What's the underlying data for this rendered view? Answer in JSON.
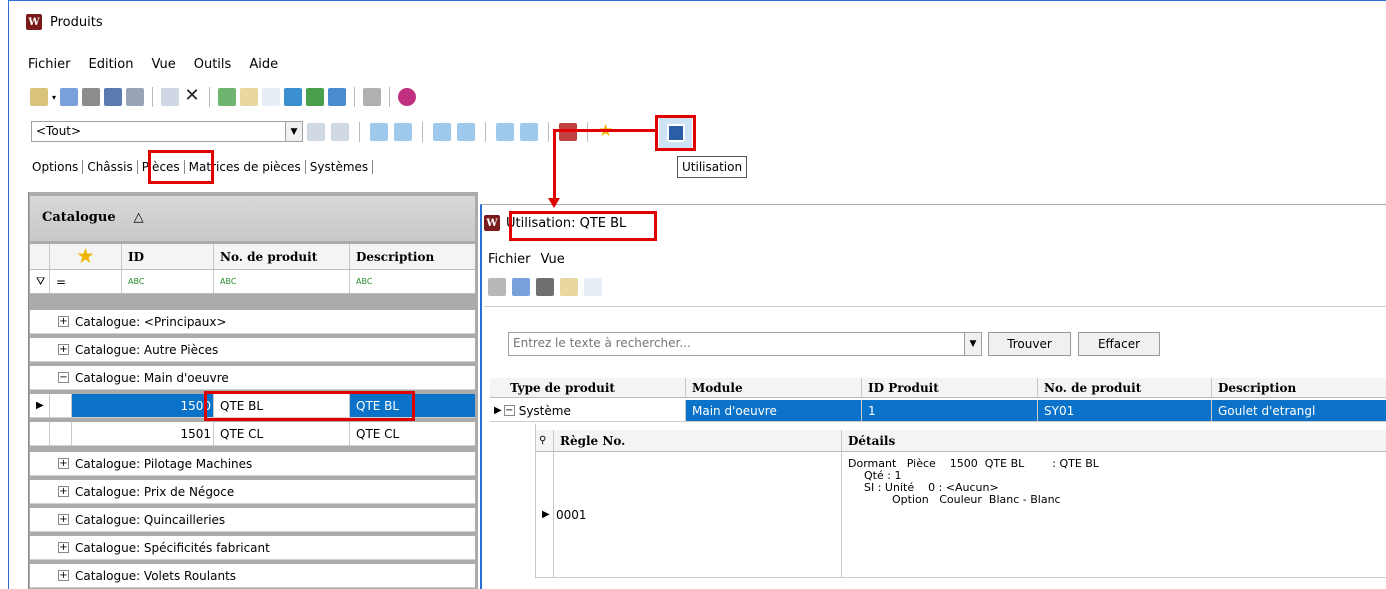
{
  "window": {
    "title": "Produits"
  },
  "menu": [
    "Fichier",
    "Edition",
    "Vue",
    "Outils",
    "Aide"
  ],
  "filter_combo": {
    "value": "<Tout>"
  },
  "tooltip": "Utilisation",
  "tabs": [
    "Options",
    "Châssis",
    "Pièces",
    "Matrices de pièces",
    "Systèmes"
  ],
  "catalog": {
    "group_header": "Catalogue",
    "sort_glyph": "△",
    "columns": [
      "ID",
      "No. de produit",
      "Description"
    ],
    "filter_glyph": "=",
    "filter_icon_text": "ABC",
    "groups": [
      {
        "label": "Catalogue: <Principaux>",
        "expander": "+"
      },
      {
        "label": "Catalogue: Autre Pièces",
        "expander": "+"
      },
      {
        "label": "Catalogue: Main d'oeuvre",
        "expander": "−"
      },
      {
        "label": "Catalogue: Pilotage Machines",
        "expander": "+"
      },
      {
        "label": "Catalogue: Prix de Négoce",
        "expander": "+"
      },
      {
        "label": "Catalogue: Quincailleries",
        "expander": "+"
      },
      {
        "label": "Catalogue: Spécificités fabricant",
        "expander": "+"
      },
      {
        "label": "Catalogue: Volets Roulants",
        "expander": "+"
      }
    ],
    "rows": [
      {
        "id": "1500",
        "product_no": "QTE BL",
        "description": "QTE BL"
      },
      {
        "id": "1501",
        "product_no": "QTE CL",
        "description": "QTE CL"
      }
    ]
  },
  "popup": {
    "title": "Utilisation: QTE BL",
    "menu": [
      "Fichier",
      "Vue"
    ],
    "search_placeholder": "Entrez le texte à rechercher...",
    "find_label": "Trouver",
    "clear_label": "Effacer",
    "columns": [
      "Type de produit",
      "Module",
      "ID Produit",
      "No. de produit",
      "Description"
    ],
    "row": {
      "expander": "−",
      "type": "Système",
      "module": "Main d'oeuvre",
      "id": "1",
      "product_no": "SY01",
      "description": "Goulet d'etrangl"
    },
    "sub_columns": [
      "Règle No.",
      "Détails"
    ],
    "sub_row": {
      "rule_no": "0001",
      "details": [
        "Dormant   Pièce    1500  QTE BL        : QTE BL",
        "Qté : 1",
        "SI : Unité    0 : <Aucun>",
        "Option   Couleur  Blanc - Blanc"
      ]
    }
  }
}
